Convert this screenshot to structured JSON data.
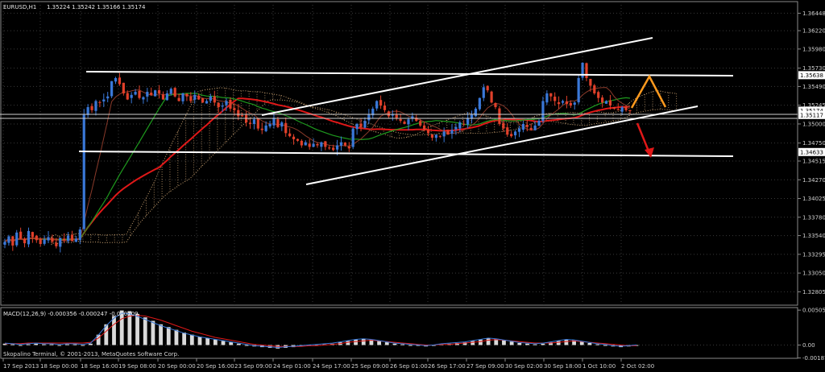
{
  "header": {
    "symbol": "EURUSD,H1",
    "ohlc": "1.35224 1.35242 1.35166 1.35174"
  },
  "macd_header": "MACD(12,26,9) -0.000356 -0.000247 -0.000109",
  "watermark": "Skopalino Terminal, © 2001-2013, MetaQuotes Software Corp.",
  "colors": {
    "background": "#000000",
    "grid": "#3a3a3a",
    "candle_up": "#3a78d8",
    "candle_down": "#e0402a",
    "ma_slow": "#e01818",
    "ma_fast": "#1e9a1e",
    "cloud": "#c8a070",
    "trend": "#ffffff",
    "forecast_up": "#ff9a1e",
    "forecast_down": "#e01818",
    "price_tag_bg": "#ffffff",
    "axis_text": "#cfcfcf"
  },
  "chart_data": [
    {
      "type": "line",
      "subtype": "candlestick",
      "title": "EURUSD,H1",
      "ylim": [
        1.3263,
        1.366
      ],
      "y_ticks": [
        "1.36448",
        "1.36220",
        "1.35980",
        "1.35730",
        "1.35490",
        "1.35245",
        "1.35000",
        "1.34750",
        "1.34515",
        "1.34270",
        "1.34025",
        "1.33780",
        "1.33540",
        "1.33295",
        "1.33050",
        "1.32805"
      ],
      "x_ticks": [
        "17 Sep 2013",
        "18 Sep 00:00",
        "18 Sep 16:00",
        "19 Sep 08:00",
        "20 Sep 00:00",
        "20 Sep 16:00",
        "23 Sep 09:00",
        "24 Sep 01:00",
        "24 Sep 17:00",
        "25 Sep 09:00",
        "26 Sep 01:00",
        "26 Sep 17:00",
        "27 Sep 09:00",
        "30 Sep 02:00",
        "30 Sep 18:00",
        "1 Oct 10:00",
        "2 Oct 02:00"
      ],
      "price_tags": [
        {
          "label": "1.35638",
          "value": 1.35638
        },
        {
          "label": "1.35174",
          "value": 1.35174
        },
        {
          "label": "1.35117",
          "value": 1.35117
        },
        {
          "label": "1.34633",
          "value": 1.34633
        }
      ],
      "grid": true,
      "close_series": [
        1.3346,
        1.3353,
        1.3341,
        1.3358,
        1.335,
        1.3344,
        1.336,
        1.3352,
        1.3348,
        1.3343,
        1.3349,
        1.3352,
        1.3346,
        1.334,
        1.3351,
        1.3348,
        1.3354,
        1.3347,
        1.335,
        1.3362,
        1.3512,
        1.3522,
        1.3518,
        1.353,
        1.3528,
        1.3532,
        1.3536,
        1.3556,
        1.356,
        1.3552,
        1.354,
        1.3532,
        1.3538,
        1.3542,
        1.3534,
        1.3535,
        1.3542,
        1.3538,
        1.3544,
        1.354,
        1.3532,
        1.354,
        1.3546,
        1.3536,
        1.353,
        1.354,
        1.3536,
        1.353,
        1.3538,
        1.3532,
        1.3528,
        1.353,
        1.3536,
        1.3528,
        1.3522,
        1.3524,
        1.353,
        1.352,
        1.3518,
        1.351,
        1.351,
        1.3502,
        1.35,
        1.3506,
        1.3494,
        1.3492,
        1.3498,
        1.35,
        1.3508,
        1.3496,
        1.3502,
        1.3488,
        1.3484,
        1.348,
        1.3478,
        1.3472,
        1.3476,
        1.347,
        1.3474,
        1.3472,
        1.3476,
        1.347,
        1.3468,
        1.3466,
        1.3472,
        1.3476,
        1.3472,
        1.3468,
        1.3494,
        1.35,
        1.3496,
        1.3504,
        1.3512,
        1.352,
        1.353,
        1.3524,
        1.3518,
        1.351,
        1.3512,
        1.3508,
        1.3504,
        1.35,
        1.3506,
        1.351,
        1.3504,
        1.3498,
        1.3492,
        1.3488,
        1.3482,
        1.3486,
        1.3484,
        1.349,
        1.3486,
        1.3492,
        1.3496,
        1.3502,
        1.35,
        1.3508,
        1.3512,
        1.352,
        1.3534,
        1.3548,
        1.3544,
        1.3528,
        1.3522,
        1.35,
        1.3494,
        1.3486,
        1.3484,
        1.349,
        1.3494,
        1.35,
        1.3496,
        1.3492,
        1.3498,
        1.3504,
        1.353,
        1.354,
        1.3536,
        1.353,
        1.3526,
        1.353,
        1.3526,
        1.3524,
        1.3528,
        1.356,
        1.358,
        1.356,
        1.355,
        1.354,
        1.3534,
        1.3528,
        1.353,
        1.3524,
        1.352,
        1.3518,
        1.3522,
        1.3518,
        1.3517
      ]
    },
    {
      "type": "bar",
      "title": "MACD(12,26,9) -0.000356 -0.000247 -0.000109",
      "ylim": [
        -0.0018,
        0.0053
      ],
      "y_ticks": [
        "0.00505",
        "0.00",
        "-0.00187"
      ],
      "histogram": [
        0.0002,
        0.0001,
        0.0,
        0.0001,
        0.0002,
        0.0001,
        0.0001,
        0.0,
        0.0001,
        0.0001,
        0.0,
        0.0002,
        0.0015,
        0.003,
        0.0042,
        0.005,
        0.0049,
        0.0045,
        0.004,
        0.0035,
        0.003,
        0.0026,
        0.0022,
        0.0018,
        0.0015,
        0.0012,
        0.001,
        0.0008,
        0.0006,
        0.0004,
        0.0002,
        0.0,
        -0.0002,
        -0.0003,
        -0.0004,
        -0.0005,
        -0.0004,
        -0.0003,
        -0.0002,
        -0.0001,
        0.0,
        0.0001,
        0.0002,
        0.0004,
        0.0006,
        0.0008,
        0.0009,
        0.0008,
        0.0006,
        0.0004,
        0.0002,
        0.0001,
        0.0,
        -0.0001,
        -0.0002,
        -0.0001,
        0.0001,
        0.0002,
        0.0003,
        0.0004,
        0.0006,
        0.0008,
        0.001,
        0.0009,
        0.0007,
        0.0005,
        0.0003,
        0.0002,
        0.0001,
        0.0002,
        0.0004,
        0.0006,
        0.0008,
        0.0007,
        0.0005,
        0.0003,
        0.0001,
        0.0,
        -0.0002,
        -0.0003,
        -0.0002,
        -0.0001
      ],
      "signal": [
        0.0002,
        0.0002,
        0.0002,
        0.0003,
        0.0003,
        0.0003,
        0.0003,
        0.0003,
        0.0003,
        0.0003,
        0.0003,
        0.0004,
        0.001,
        0.002,
        0.003,
        0.0038,
        0.0042,
        0.0043,
        0.0042,
        0.0039,
        0.0036,
        0.0032,
        0.0028,
        0.0024,
        0.002,
        0.0017,
        0.0014,
        0.0011,
        0.0009,
        0.0007,
        0.0005,
        0.0003,
        0.0001,
        0.0,
        -0.0001,
        -0.0002,
        -0.0002,
        -0.0002,
        -0.0002,
        -0.0001,
        -0.0001,
        0.0,
        0.0001,
        0.0002,
        0.0004,
        0.0005,
        0.0006,
        0.0007,
        0.0006,
        0.0005,
        0.0004,
        0.0003,
        0.0002,
        0.0001,
        0.0,
        0.0,
        0.0001,
        0.0001,
        0.0002,
        0.0003,
        0.0004,
        0.0005,
        0.0007,
        0.0008,
        0.0007,
        0.0006,
        0.0005,
        0.0004,
        0.0003,
        0.0003,
        0.0003,
        0.0004,
        0.0005,
        0.0006,
        0.0005,
        0.0004,
        0.0003,
        0.0002,
        0.0001,
        0.0,
        -0.0001,
        -0.0001
      ]
    }
  ]
}
